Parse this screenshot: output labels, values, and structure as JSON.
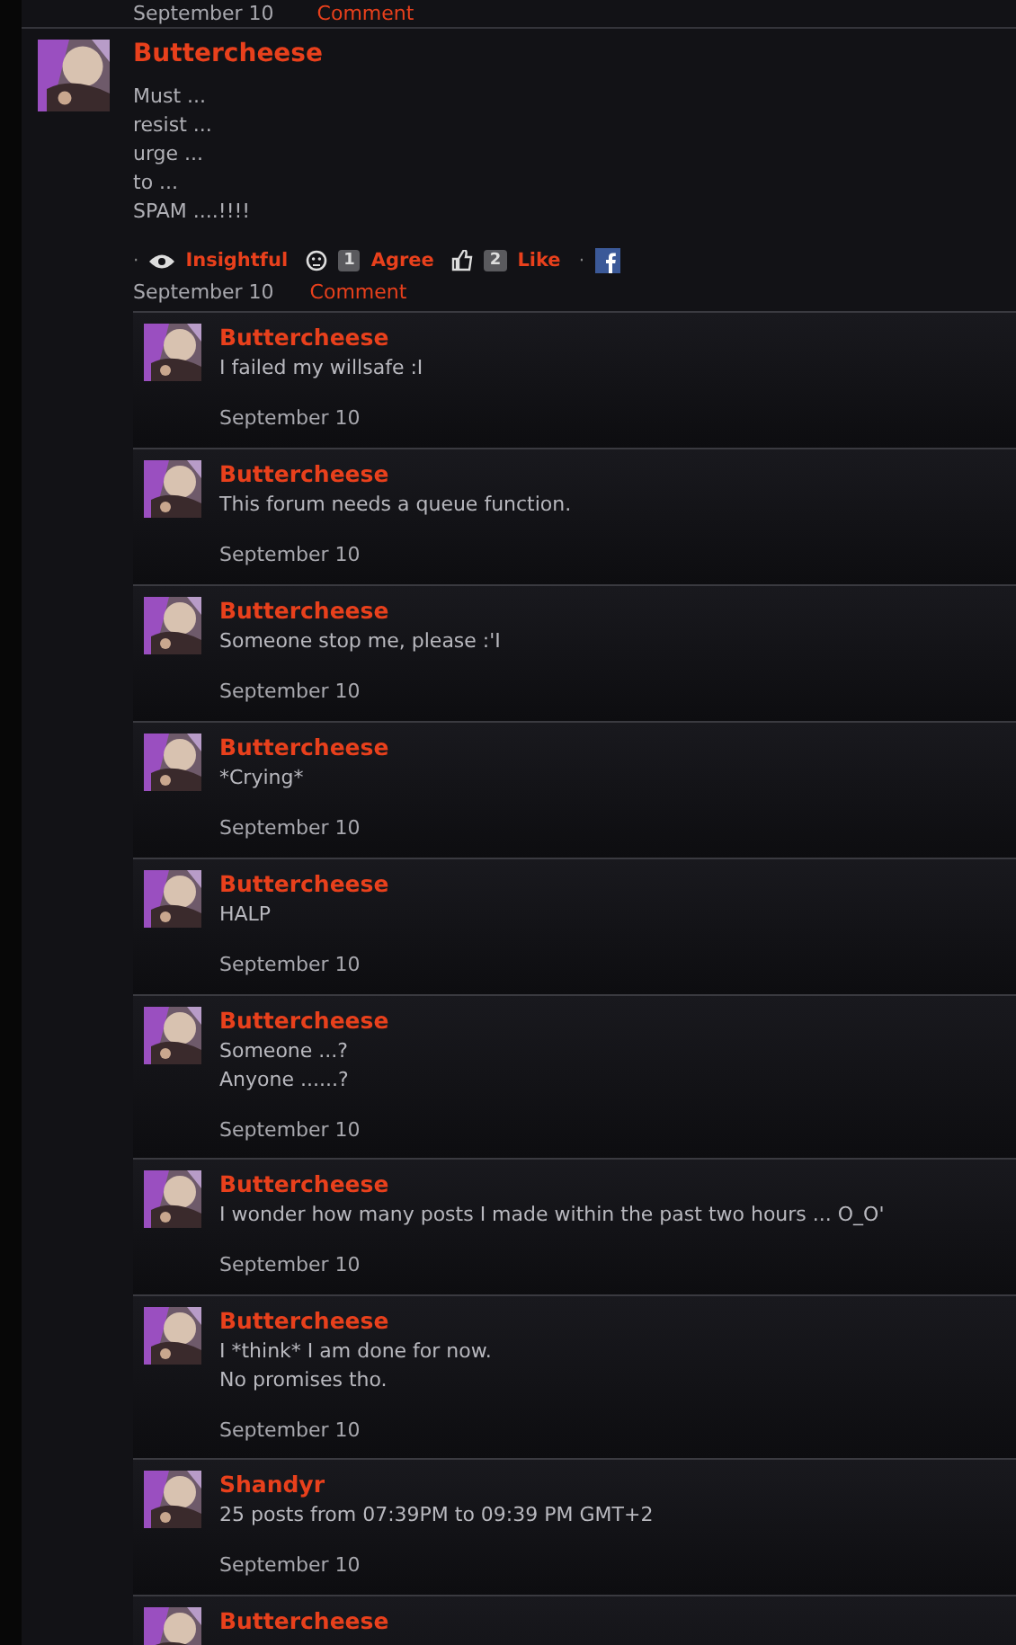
{
  "previous_post_footer": {
    "date": "September 10",
    "comment_link": "Comment"
  },
  "post": {
    "author": "Buttercheese",
    "body_lines": [
      "Must ...",
      "resist ...",
      "urge ...",
      "to ...",
      "SPAM ....!!!!"
    ],
    "separator": "·",
    "reactions": [
      {
        "kind": "eye",
        "label": "Insightful"
      },
      {
        "kind": "face",
        "count": "1",
        "label": "Agree"
      },
      {
        "kind": "thumb",
        "count": "2",
        "label": "Like"
      }
    ],
    "date": "September 10",
    "comment_link": "Comment"
  },
  "comments": [
    {
      "author": "Buttercheese",
      "lines": [
        "I failed my willsafe :I"
      ],
      "date": "September 10"
    },
    {
      "author": "Buttercheese",
      "lines": [
        "This forum needs a queue function."
      ],
      "date": "September 10"
    },
    {
      "author": "Buttercheese",
      "lines": [
        "Someone stop me, please :'I"
      ],
      "date": "September 10"
    },
    {
      "author": "Buttercheese",
      "lines": [
        "*Crying*"
      ],
      "date": "September 10"
    },
    {
      "author": "Buttercheese",
      "lines": [
        "HALP"
      ],
      "date": "September 10"
    },
    {
      "author": "Buttercheese",
      "lines": [
        "Someone ...?",
        "Anyone ......?"
      ],
      "date": "September 10"
    },
    {
      "author": "Buttercheese",
      "lines": [
        "I wonder how many posts I made within the past two hours ... O_O'"
      ],
      "date": "September 10"
    },
    {
      "author": "Buttercheese",
      "lines": [
        "I *think* I am done for now.",
        "No promises tho."
      ],
      "date": "September 10"
    },
    {
      "author": "Shandyr",
      "lines": [
        "25 posts from 07:39PM to 09:39 PM GMT+2"
      ],
      "date": "September 10"
    },
    {
      "author": "Buttercheese"
    }
  ]
}
